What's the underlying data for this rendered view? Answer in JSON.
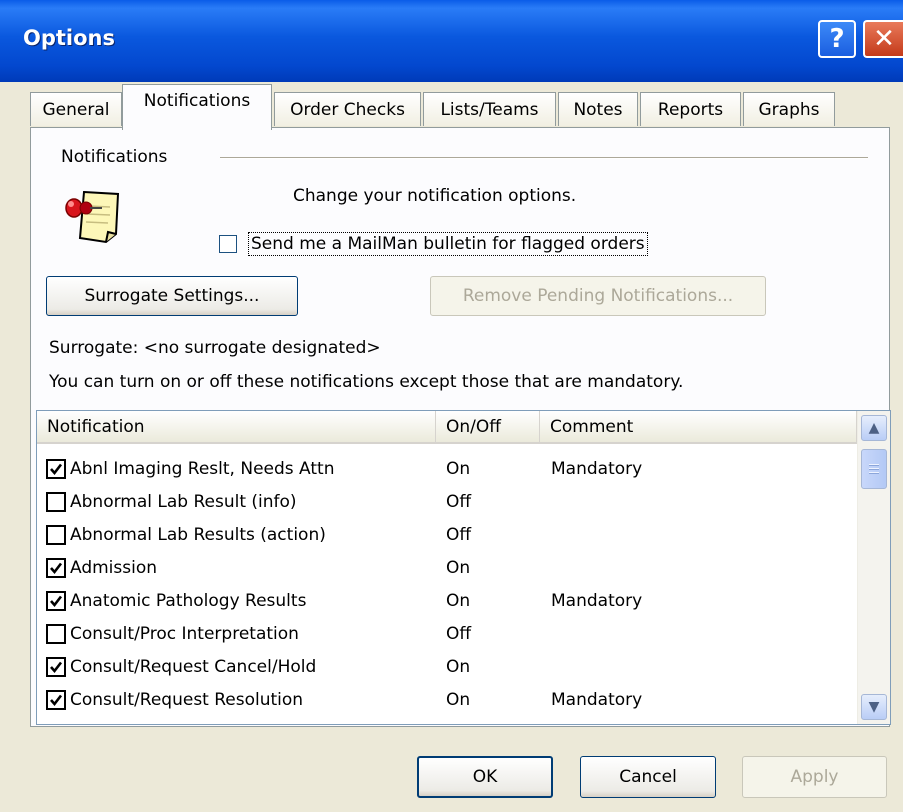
{
  "window": {
    "title": "Options",
    "help_glyph": "?",
    "close_glyph": "✕",
    "title_color": "#0a58de"
  },
  "tabs": [
    {
      "label": "General",
      "active": false
    },
    {
      "label": "Notifications",
      "active": true
    },
    {
      "label": "Order Checks",
      "active": false
    },
    {
      "label": "Lists/Teams",
      "active": false
    },
    {
      "label": "Notes",
      "active": false
    },
    {
      "label": "Reports",
      "active": false
    },
    {
      "label": "Graphs",
      "active": false
    }
  ],
  "notifications": {
    "group_label": "Notifications",
    "description": "Change your notification options.",
    "mailman_checkbox_label": "Send me a MailMan bulletin for flagged orders",
    "mailman_checked": false,
    "surrogate_button": "Surrogate Settings...",
    "remove_pending_button": "Remove Pending Notifications...",
    "surrogate_text": "Surrogate:  <no surrogate designated>",
    "info_text": "You can turn on or off these notifications except those that are mandatory.",
    "icon": "notepad-pushpin-icon"
  },
  "list": {
    "columns": [
      "Notification",
      "On/Off",
      "Comment"
    ],
    "rows": [
      {
        "checked": true,
        "name": "Abnl Imaging Reslt, Needs Attn",
        "state": "On",
        "comment": "Mandatory"
      },
      {
        "checked": false,
        "name": "Abnormal Lab Result (info)",
        "state": "Off",
        "comment": ""
      },
      {
        "checked": false,
        "name": "Abnormal Lab Results (action)",
        "state": "Off",
        "comment": ""
      },
      {
        "checked": true,
        "name": "Admission",
        "state": "On",
        "comment": ""
      },
      {
        "checked": true,
        "name": "Anatomic Pathology Results",
        "state": "On",
        "comment": "Mandatory"
      },
      {
        "checked": false,
        "name": "Consult/Proc Interpretation",
        "state": "Off",
        "comment": ""
      },
      {
        "checked": true,
        "name": "Consult/Request Cancel/Hold",
        "state": "On",
        "comment": ""
      },
      {
        "checked": true,
        "name": "Consult/Request Resolution",
        "state": "On",
        "comment": "Mandatory"
      }
    ]
  },
  "footer": {
    "ok": "OK",
    "cancel": "Cancel",
    "apply": "Apply"
  }
}
